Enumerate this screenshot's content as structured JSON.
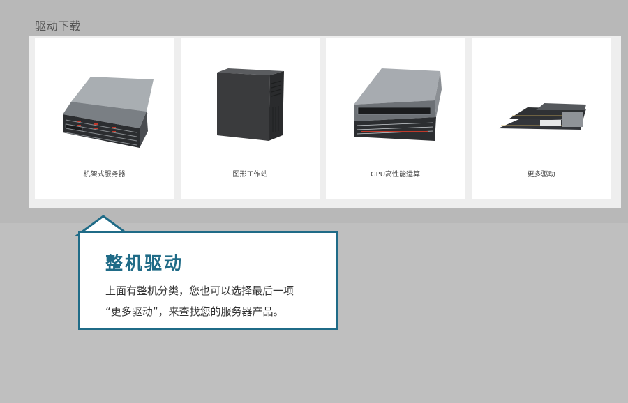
{
  "section": {
    "title": "驱动下载"
  },
  "categories": [
    {
      "label": "机架式服务器",
      "image": "rack-server-image"
    },
    {
      "label": "图形工作站",
      "image": "tower-workstation-image"
    },
    {
      "label": "GPU高性能运算",
      "image": "gpu-server-image"
    },
    {
      "label": "更多驱动",
      "image": "more-servers-image"
    }
  ],
  "callout": {
    "title": "整机驱动",
    "line1": "上面有整机分类，您也可以选择最后一项",
    "line2": "“更多驱动”，来查找您的服务器产品。"
  },
  "colors": {
    "accent": "#1f6b87",
    "background": "#bfbfbf",
    "card": "#ffffff"
  }
}
